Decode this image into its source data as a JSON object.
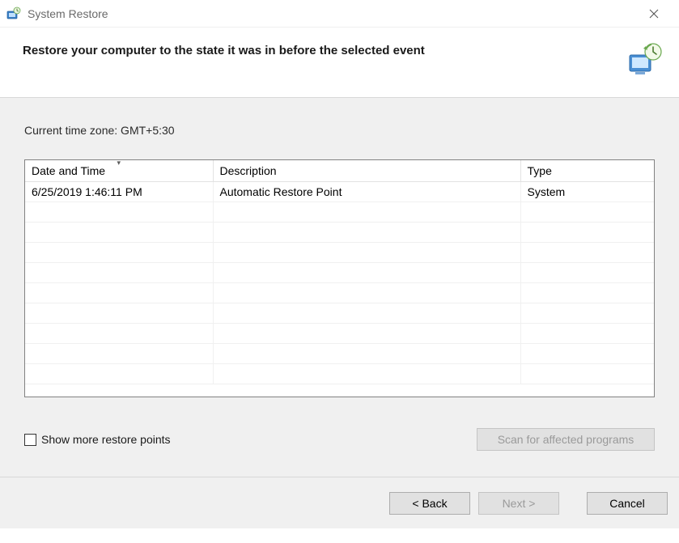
{
  "window": {
    "title": "System Restore"
  },
  "header": {
    "heading": "Restore your computer to the state it was in before the selected event"
  },
  "content": {
    "timezone_label": "Current time zone: GMT+5:30",
    "columns": {
      "datetime": "Date and Time",
      "description": "Description",
      "type": "Type"
    },
    "rows": [
      {
        "datetime": "6/25/2019 1:46:11 PM",
        "description": "Automatic Restore Point",
        "type": "System"
      }
    ],
    "show_more_label": "Show more restore points",
    "scan_button": "Scan for affected programs"
  },
  "footer": {
    "back": "< Back",
    "next": "Next >",
    "cancel": "Cancel"
  }
}
